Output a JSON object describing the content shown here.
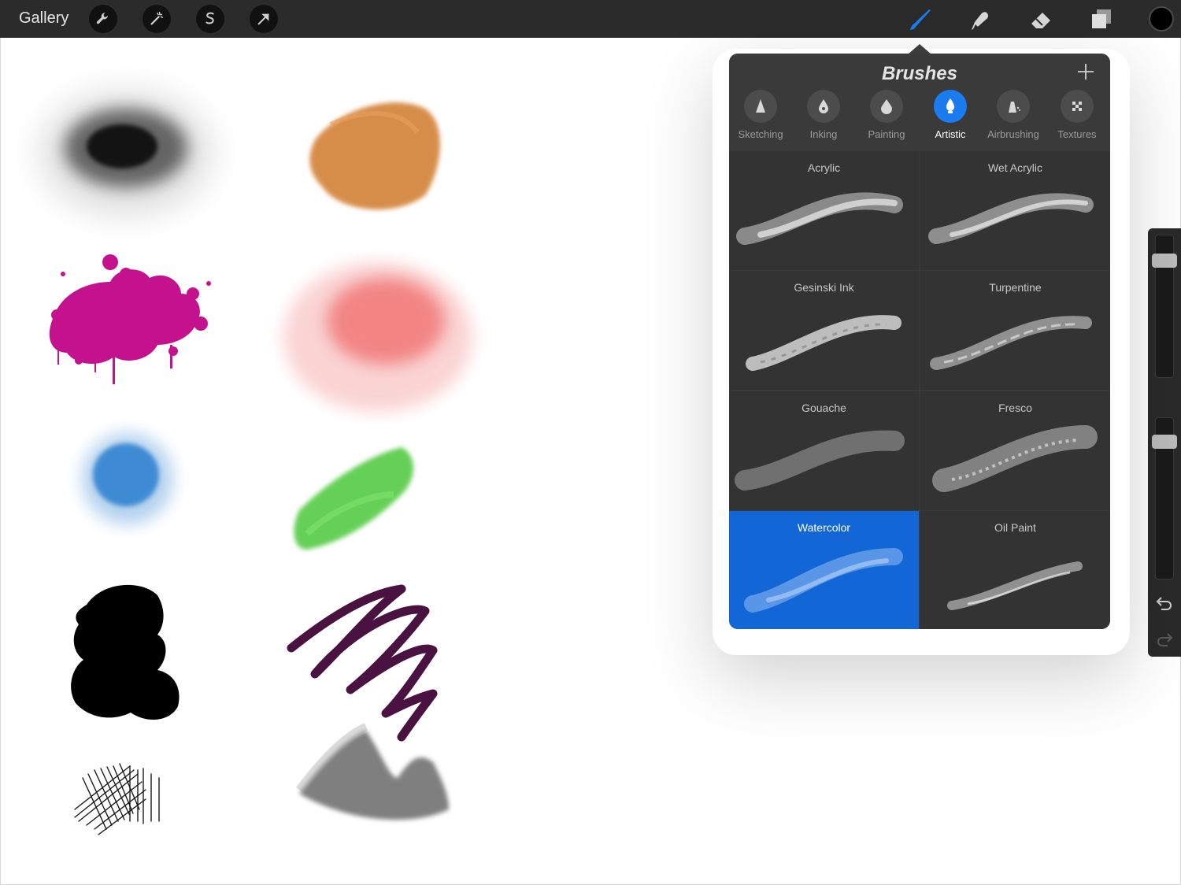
{
  "toolbar": {
    "gallery_label": "Gallery",
    "left_tools": [
      "wrench-icon",
      "magic-wand-icon",
      "selection-icon",
      "transform-arrow-icon"
    ],
    "right_tools": [
      "brush-icon",
      "smudge-icon",
      "eraser-icon",
      "layers-icon"
    ],
    "active_tool": "brush-icon",
    "current_color": "#000000"
  },
  "brushes_panel": {
    "title": "Brushes",
    "categories": [
      {
        "label": "Sketching",
        "icon": "pencil-tip-icon"
      },
      {
        "label": "Inking",
        "icon": "ink-drop-icon"
      },
      {
        "label": "Painting",
        "icon": "paint-drop-icon"
      },
      {
        "label": "Artistic",
        "icon": "artistic-brush-icon"
      },
      {
        "label": "Airbrushing",
        "icon": "airbrush-icon"
      },
      {
        "label": "Textures",
        "icon": "texture-icon"
      }
    ],
    "active_category": "Artistic",
    "brushes": [
      {
        "name": "Acrylic"
      },
      {
        "name": "Wet Acrylic"
      },
      {
        "name": "Gesinski Ink"
      },
      {
        "name": "Turpentine"
      },
      {
        "name": "Gouache"
      },
      {
        "name": "Fresco"
      },
      {
        "name": "Watercolor"
      },
      {
        "name": "Oil Paint"
      }
    ],
    "selected_brush": "Watercolor",
    "accent_color": "#1b7cf0",
    "selected_cell_color": "#1266d6"
  },
  "side_panel": {
    "brush_size_level": 0.1,
    "opacity_level": 0.1,
    "undo_icon": "undo-icon",
    "redo_icon": "redo-icon"
  },
  "canvas_strokes": [
    {
      "name": "black-spray-stroke",
      "color": "#111111"
    },
    {
      "name": "orange-chalk-stroke",
      "color": "#d07a2c"
    },
    {
      "name": "magenta-splatter-stroke",
      "color": "#c4128f"
    },
    {
      "name": "red-watercolor-stroke",
      "color": "#f06a6a"
    },
    {
      "name": "blue-airbrush-stroke",
      "color": "#2a7fd0"
    },
    {
      "name": "green-paint-stroke",
      "color": "#4cc83a"
    },
    {
      "name": "black-ink-blob-stroke",
      "color": "#000000"
    },
    {
      "name": "purple-scribble-stroke",
      "color": "#4a1240"
    },
    {
      "name": "hatching-stroke",
      "color": "#1a1a1a"
    },
    {
      "name": "charcoal-stroke",
      "color": "#555555"
    }
  ]
}
